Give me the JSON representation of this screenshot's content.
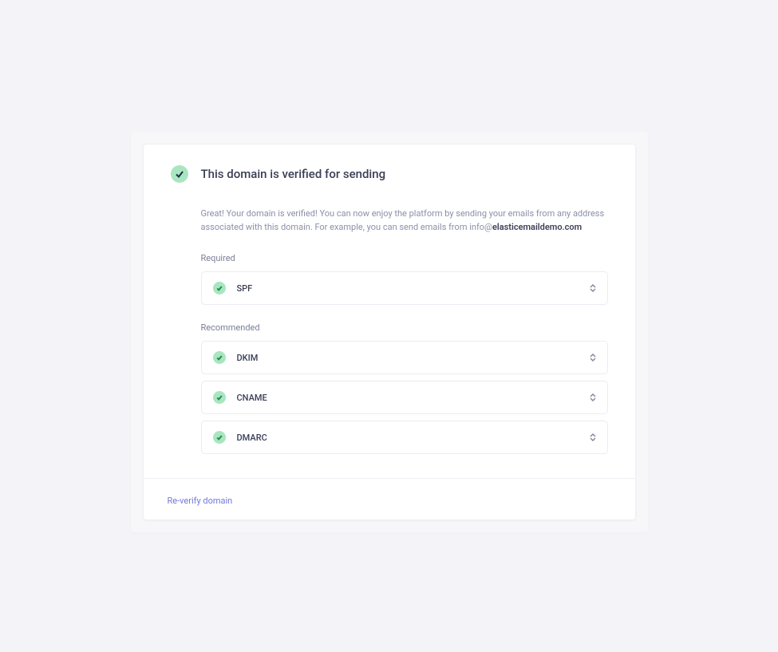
{
  "header": {
    "title": "This domain is verified for sending"
  },
  "description": {
    "text_before": "Great! Your domain is verified! You can now enjoy the platform by sending your emails from any address associated with this domain. For example, you can send emails from info@",
    "domain": "elasticemaildemo.com"
  },
  "sections": {
    "required": {
      "label": "Required",
      "items": [
        {
          "name": "SPF"
        }
      ]
    },
    "recommended": {
      "label": "Recommended",
      "items": [
        {
          "name": "DKIM"
        },
        {
          "name": "CNAME"
        },
        {
          "name": "DMARC"
        }
      ]
    }
  },
  "footer": {
    "reverify": "Re-verify domain"
  }
}
